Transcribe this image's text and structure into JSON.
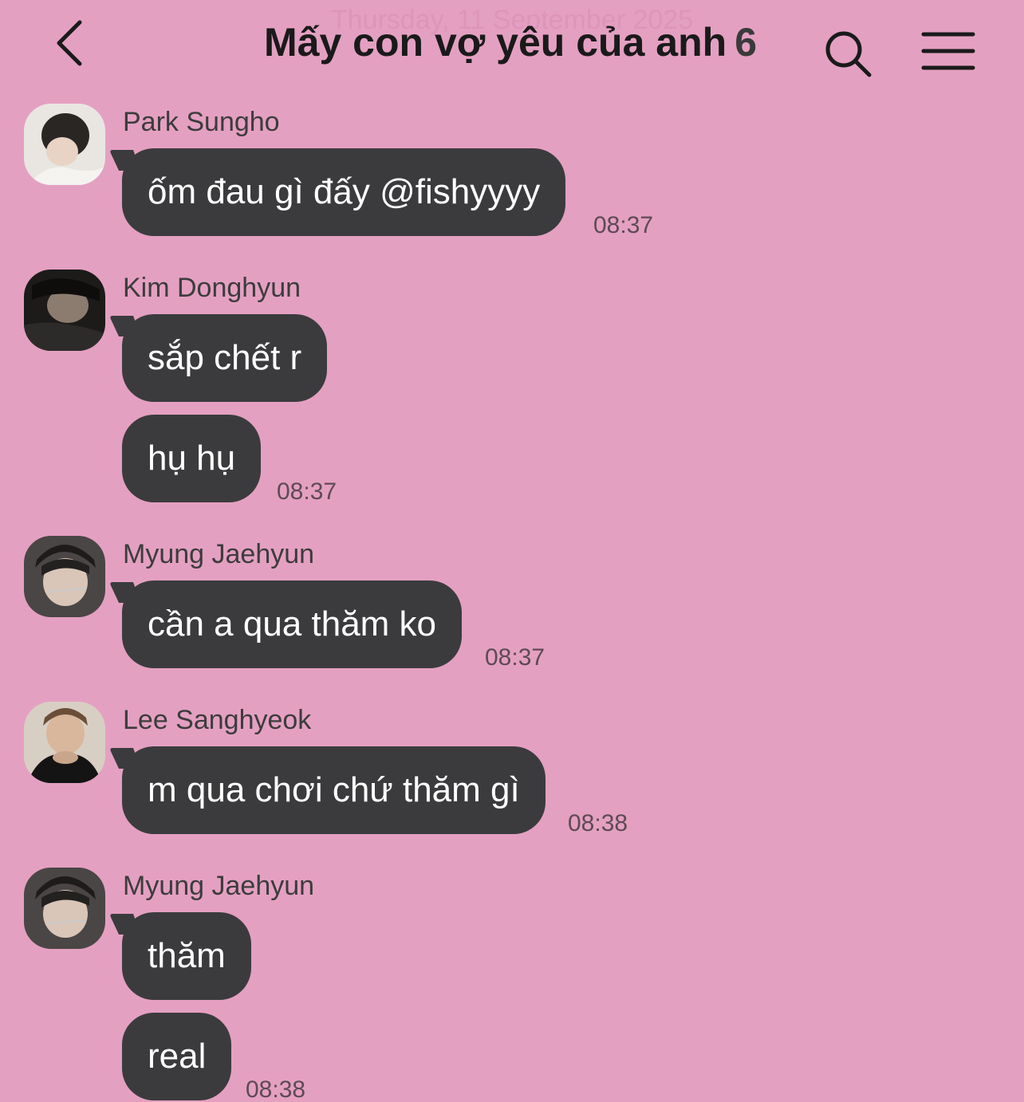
{
  "header": {
    "date_ghost": "Thursday, 11 September 2025",
    "title": "Mấy con vợ yêu của anh",
    "member_count": "6"
  },
  "colors": {
    "background": "#e4a0c1",
    "bubble": "#3b3b3d",
    "bubble_text": "#ffffff"
  },
  "icons": {
    "back": "chevron-left-icon",
    "search": "search-icon",
    "menu": "menu-icon"
  },
  "messages": [
    {
      "sender": "Park Sungho",
      "text": "ốm đau gì đấy @fishyyyy",
      "time": "08:37"
    },
    {
      "sender": "Kim Donghyun",
      "text": "sắp chết r"
    },
    {
      "text": "hụ hụ",
      "time": "08:37"
    },
    {
      "sender": "Myung Jaehyun",
      "text": "cần a qua thăm ko",
      "time": "08:37"
    },
    {
      "sender": "Lee Sanghyeok",
      "text": "m qua chơi chứ thăm gì",
      "time": "08:38"
    },
    {
      "sender": "Myung Jaehyun",
      "text": "thăm"
    },
    {
      "text": "real",
      "time": "08:38"
    }
  ]
}
